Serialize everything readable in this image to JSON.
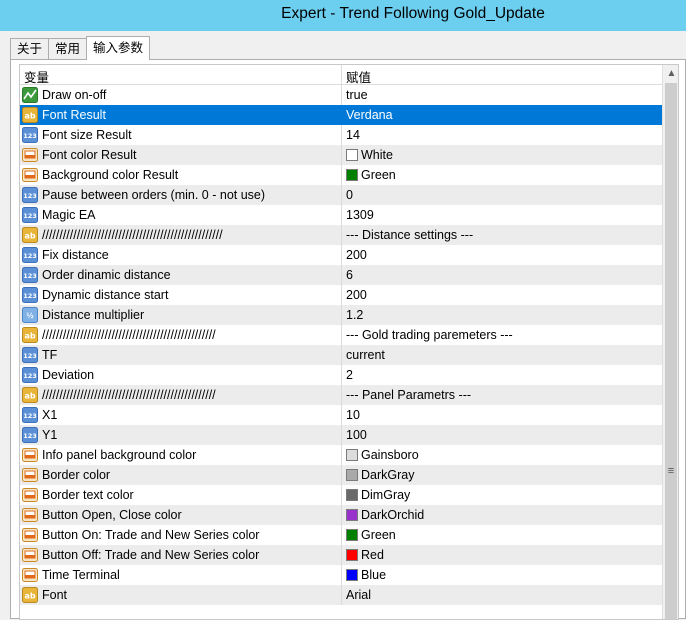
{
  "window": {
    "title": "Expert - Trend Following Gold_Update"
  },
  "tabs": [
    {
      "label": "关于"
    },
    {
      "label": "常用"
    },
    {
      "label": "输入参数"
    }
  ],
  "grid": {
    "col_variable": "变量",
    "col_value": "赋值",
    "rows": [
      {
        "icon": "chart-icon",
        "name": "Draw on-off",
        "value": "true",
        "swatch": ""
      },
      {
        "icon": "ab-icon",
        "name": "Font Result",
        "value": "Verdana",
        "swatch": "",
        "selected": true
      },
      {
        "icon": "num-icon",
        "name": "Font size Result",
        "value": "14",
        "swatch": ""
      },
      {
        "icon": "color-icon",
        "name": "Font color Result",
        "value": "White",
        "swatch": "#ffffff"
      },
      {
        "icon": "color-icon",
        "name": "Background color Result",
        "value": "Green",
        "swatch": "#008000"
      },
      {
        "icon": "num-icon",
        "name": "Pause between orders (min. 0 - not use)",
        "value": "0",
        "swatch": ""
      },
      {
        "icon": "num-icon",
        "name": "Magic EA",
        "value": "1309",
        "swatch": ""
      },
      {
        "icon": "ab-icon",
        "name": "////////////////////////////////////////////////////",
        "value": "--- Distance settings ---",
        "swatch": ""
      },
      {
        "icon": "num-icon",
        "name": "Fix distance",
        "value": "200",
        "swatch": ""
      },
      {
        "icon": "num-icon",
        "name": "Order dinamic distance",
        "value": "6",
        "swatch": ""
      },
      {
        "icon": "num-icon",
        "name": "Dynamic distance start",
        "value": "200",
        "swatch": ""
      },
      {
        "icon": "frac-icon",
        "name": "Distance multiplier",
        "value": "1.2",
        "swatch": ""
      },
      {
        "icon": "ab-icon",
        "name": "//////////////////////////////////////////////////",
        "value": "--- Gold trading paremeters ---",
        "swatch": ""
      },
      {
        "icon": "num-icon",
        "name": "TF",
        "value": "current",
        "swatch": ""
      },
      {
        "icon": "num-icon",
        "name": "Deviation",
        "value": "2",
        "swatch": ""
      },
      {
        "icon": "ab-icon",
        "name": "//////////////////////////////////////////////////",
        "value": "--- Panel Parametrs ---",
        "swatch": ""
      },
      {
        "icon": "num-icon",
        "name": "X1",
        "value": "10",
        "swatch": ""
      },
      {
        "icon": "num-icon",
        "name": "Y1",
        "value": "100",
        "swatch": ""
      },
      {
        "icon": "color-icon",
        "name": "Info panel background color",
        "value": "Gainsboro",
        "swatch": "#dcdcdc"
      },
      {
        "icon": "color-icon",
        "name": "Border color",
        "value": "DarkGray",
        "swatch": "#a9a9a9"
      },
      {
        "icon": "color-icon",
        "name": "Border text color",
        "value": "DimGray",
        "swatch": "#696969"
      },
      {
        "icon": "color-icon",
        "name": "Button Open, Close color",
        "value": "DarkOrchid",
        "swatch": "#9932cc"
      },
      {
        "icon": "color-icon",
        "name": "Button On: Trade and New Series color",
        "value": "Green",
        "swatch": "#008000"
      },
      {
        "icon": "color-icon",
        "name": "Button Off: Trade and New Series color",
        "value": "Red",
        "swatch": "#ff0000"
      },
      {
        "icon": "color-icon",
        "name": "Time Terminal",
        "value": "Blue",
        "swatch": "#0000ff"
      },
      {
        "icon": "ab-icon",
        "name": "Font",
        "value": "Arial",
        "swatch": ""
      }
    ]
  },
  "colors": {
    "titlebar": "#6ccff0",
    "selection": "#0078d7"
  }
}
